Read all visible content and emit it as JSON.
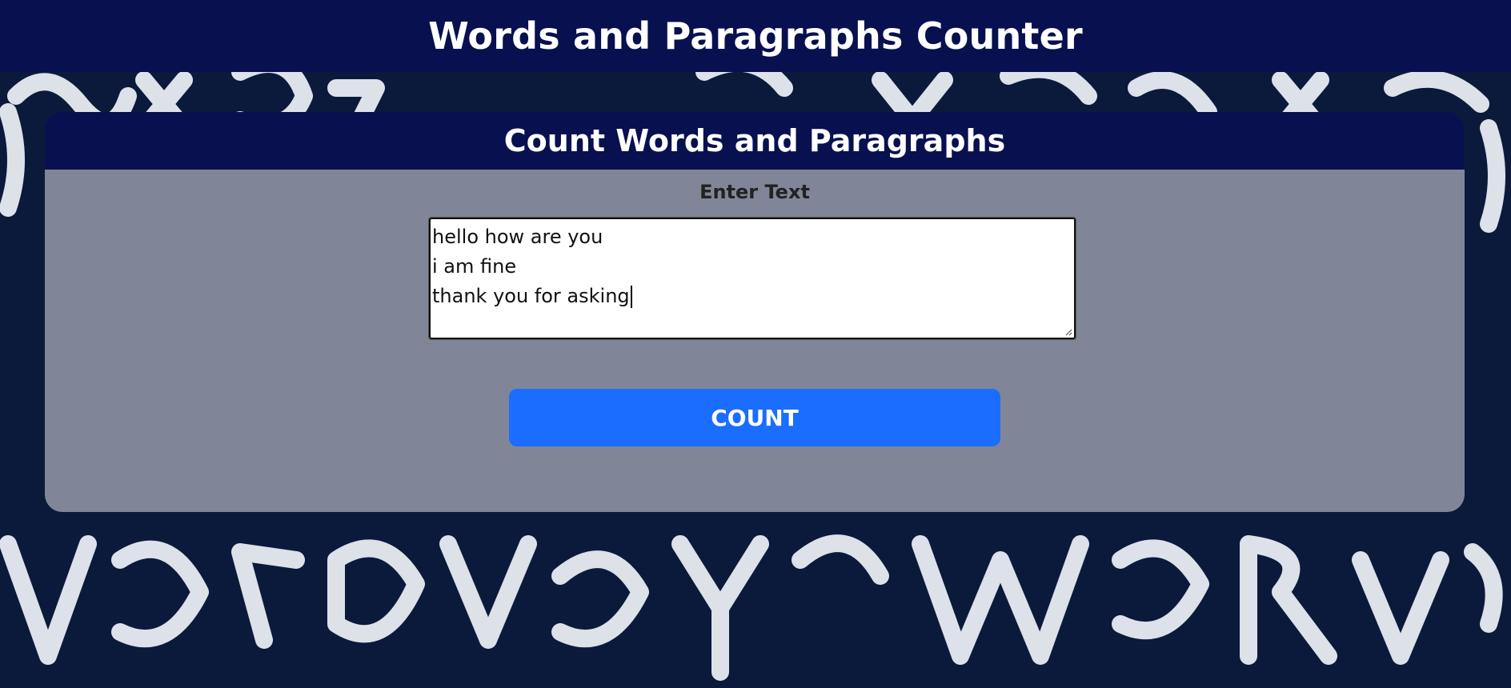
{
  "header": {
    "title": "Words and Paragraphs Counter"
  },
  "card": {
    "title": "Count Words and Paragraphs",
    "input_label": "Enter Text",
    "text_lines": [
      "hello how are you",
      "i am fine",
      "thank you for asking"
    ],
    "button_label": "COUNT"
  },
  "colors": {
    "header_bg": "#08104f",
    "button_bg": "#1a6dff",
    "page_bg": "#0a1a3a"
  }
}
